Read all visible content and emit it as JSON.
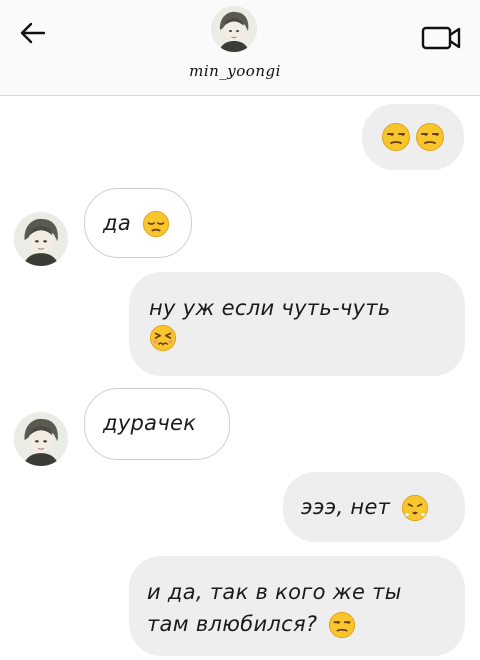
{
  "header": {
    "username": "min_yoongi",
    "back_icon": "arrow-left-icon",
    "video_icon": "video-camera-icon"
  },
  "messages": [
    {
      "from": "me",
      "text": "",
      "emojis": [
        "unamused",
        "unamused"
      ]
    },
    {
      "from": "them",
      "text": "да",
      "emojis": [
        "pensive"
      ]
    },
    {
      "from": "me",
      "text": "ну уж если чуть-чуть",
      "emojis": [
        "persevering"
      ]
    },
    {
      "from": "them",
      "text": "дурачек",
      "emojis": []
    },
    {
      "from": "me",
      "text": "эээ, нет",
      "emojis": [
        "triumph"
      ]
    },
    {
      "from": "me",
      "text": "и да, так в кого же ты там влюбился?",
      "emojis": [
        "unamused"
      ]
    }
  ],
  "colors": {
    "outgoing_bubble": "#eeeeef",
    "incoming_bubble_border": "#cfcfcf",
    "emoji_yellow": "#f7c52c"
  }
}
